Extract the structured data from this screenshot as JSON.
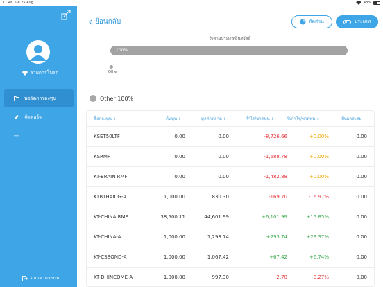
{
  "statusbar": {
    "time": "11:46",
    "date": "Tue 25 Aug",
    "battery": "48%"
  },
  "sidebar": {
    "favorite_label": "รายการโปรด",
    "menu": [
      {
        "label": "พอร์ตการลงทุน",
        "icon": "folder-icon"
      },
      {
        "label": "จัดพอร์ต",
        "icon": "pencil-icon"
      },
      {
        "label": ""
      }
    ],
    "logout_label": "ออกจากระบบ"
  },
  "header": {
    "back_label": "ย้อนกลับ",
    "proportion_label": "สัดส่วน",
    "type_label": "ประเภท"
  },
  "allocation": {
    "title": "%ตามประเภทสินทรัพย์",
    "bar_text": "100%",
    "bar_fraction": 1.0,
    "category": "Other",
    "legend_text": "Other 100%",
    "color": "#a3a3a3"
  },
  "table": {
    "columns": [
      "ชื่อกองทุน",
      "ต้นทุน",
      "มูลค่าตลาด",
      "กำไร/ขาดทุน",
      "%กำไร/ขาดทุน",
      "ปันผลสะสม"
    ],
    "rows": [
      {
        "name": "KSET50LTF",
        "cost": "0.00",
        "market": "0.00",
        "pl": "-8,726.66",
        "plpct": "+0.00%",
        "div": "0.00"
      },
      {
        "name": "KSRMF",
        "cost": "0.00",
        "market": "0.00",
        "pl": "-1,688.78",
        "plpct": "+0.00%",
        "div": "0.00"
      },
      {
        "name": "KT-BRAIN RMF",
        "cost": "0.00",
        "market": "0.00",
        "pl": "-1,482.88",
        "plpct": "+0.00%",
        "div": "0.00"
      },
      {
        "name": "KTBTHAICG-A",
        "cost": "1,000.00",
        "market": "830.30",
        "pl": "-169.70",
        "plpct": "-16.97%",
        "div": "0.00"
      },
      {
        "name": "KT-CHINA RMF",
        "cost": "38,500.11",
        "market": "44,601.99",
        "pl": "+6,101.99",
        "plpct": "+15.85%",
        "div": "0.00"
      },
      {
        "name": "KT-CHINA-A",
        "cost": "1,000.00",
        "market": "1,293.74",
        "pl": "+293.74",
        "plpct": "+29.37%",
        "div": "0.00"
      },
      {
        "name": "KT-CSBOND-A",
        "cost": "1,000.00",
        "market": "1,067.42",
        "pl": "+67.42",
        "plpct": "+6.74%",
        "div": "0.00"
      },
      {
        "name": "KT-DHINCOME-A",
        "cost": "1,000.00",
        "market": "997.30",
        "pl": "-2.70",
        "plpct": "-0.27%",
        "div": "0.00"
      }
    ]
  }
}
